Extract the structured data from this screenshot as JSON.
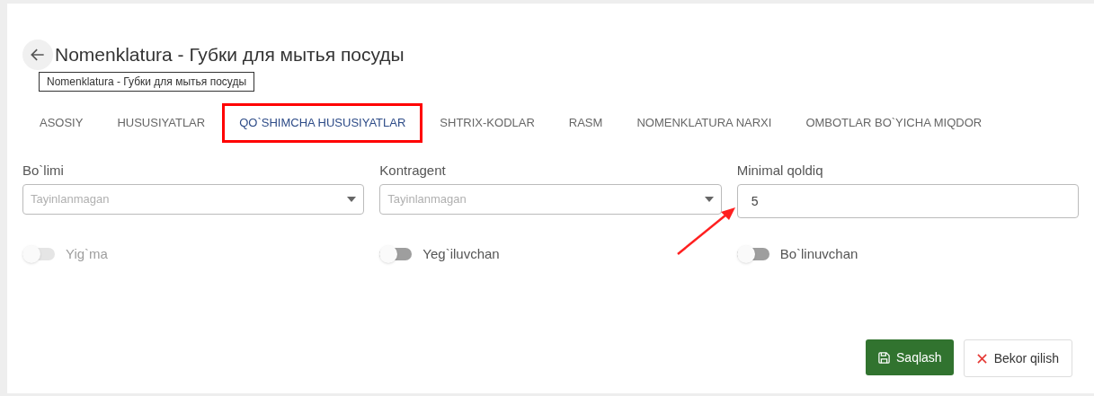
{
  "header": {
    "title": "Nomenklatura - Губки для мытья посуды",
    "tooltip": "Nomenklatura - Губки для мытья посуды"
  },
  "tabs": [
    {
      "label": "ASOSIY",
      "selected": false,
      "highlighted": false
    },
    {
      "label": "HUSUSIYATLAR",
      "selected": false,
      "highlighted": false
    },
    {
      "label": "QO`SHIMCHA HUSUSIYATLAR",
      "selected": true,
      "highlighted": true
    },
    {
      "label": "SHTRIX-KODLAR",
      "selected": false,
      "highlighted": false
    },
    {
      "label": "RASM",
      "selected": false,
      "highlighted": false
    },
    {
      "label": "NOMENKLATURA NARXI",
      "selected": false,
      "highlighted": false
    },
    {
      "label": "OMBOTLAR BO`YICHA MIQDOR",
      "selected": false,
      "highlighted": false
    }
  ],
  "fields": [
    {
      "kind": "select",
      "label": "Bo`limi",
      "placeholder": "Tayinlanmagan"
    },
    {
      "kind": "select",
      "label": "Kontragent",
      "placeholder": "Tayinlanmagan"
    },
    {
      "kind": "input",
      "label": "Minimal qoldiq",
      "value": "5"
    }
  ],
  "toggles": [
    {
      "label": "Yig`ma",
      "on": false,
      "disabled": true
    },
    {
      "label": "Yeg`iluvchan",
      "on": false,
      "disabled": false
    },
    {
      "label": "Bo`linuvchan",
      "on": false,
      "disabled": false
    }
  ],
  "buttons": [
    {
      "kind": "save",
      "label": "Saqlash"
    },
    {
      "kind": "cancel",
      "label": "Bekor qilish"
    }
  ]
}
